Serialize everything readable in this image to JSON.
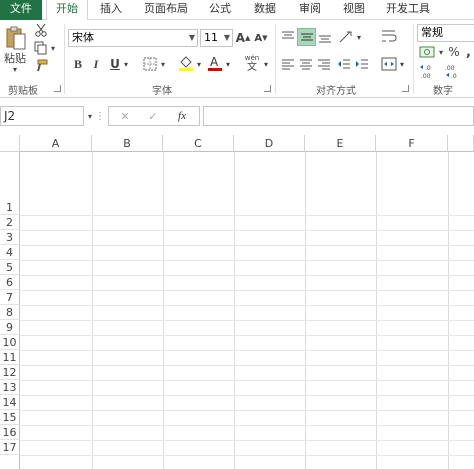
{
  "tabs": [
    "文件",
    "开始",
    "插入",
    "页面布局",
    "公式",
    "数据",
    "审阅",
    "视图",
    "开发工具"
  ],
  "clipboard": {
    "paste_label": "粘贴",
    "group_label": "剪贴板"
  },
  "font": {
    "name": "宋体",
    "size": "11",
    "group_label": "字体",
    "bold": "B",
    "italic": "I",
    "underline": "U",
    "grow": "A",
    "shrink": "A",
    "phonetic": "wén",
    "phonetic_sub": "文"
  },
  "alignment": {
    "group_label": "对齐方式"
  },
  "number": {
    "format": "常规",
    "group_label": "数字",
    "percent": "%",
    "comma": ",",
    "inc_decimal": "←.0\n.00",
    "dec_decimal": ".00\n→.0"
  },
  "formula_bar": {
    "name_box": "J2",
    "cancel": "✕",
    "enter": "✓",
    "fx": "fx",
    "value": ""
  },
  "columns": [
    "A",
    "B",
    "C",
    "D",
    "E",
    "F"
  ],
  "rows": [
    "1",
    "2",
    "3",
    "4",
    "5",
    "6",
    "7",
    "8",
    "9",
    "10",
    "11",
    "12",
    "13",
    "14",
    "15",
    "16",
    "17"
  ]
}
